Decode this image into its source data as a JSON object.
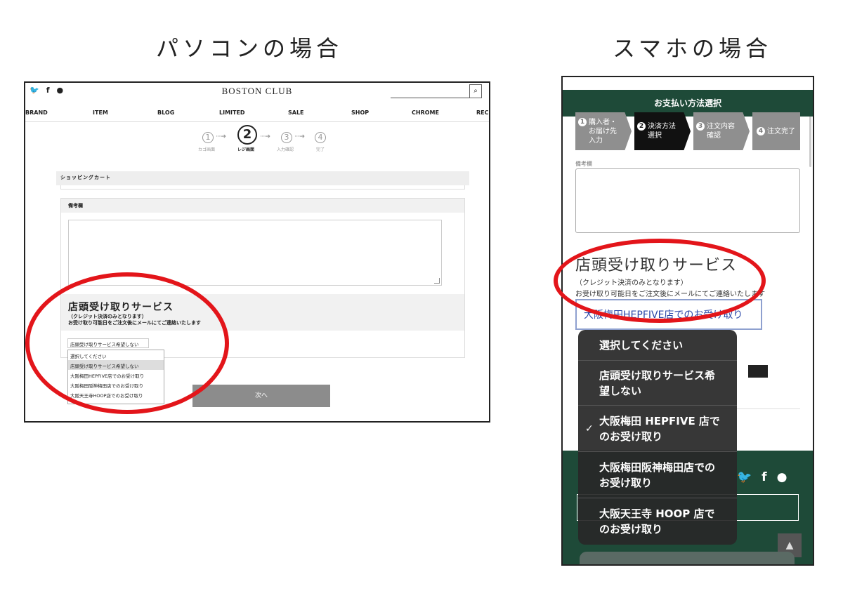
{
  "headings": {
    "pc": "パソコンの場合",
    "phone": "スマホの場合"
  },
  "pc": {
    "brand": "BOSTON CLUB",
    "social_icons": [
      "twitter-icon",
      "facebook-icon",
      "line-icon"
    ],
    "nav": [
      "BRAND",
      "ITEM",
      "BLOG",
      "LIMITED",
      "SALE",
      "SHOP",
      "CHROME",
      "RECI"
    ],
    "steps": [
      {
        "num": "1",
        "label": "カゴ画面"
      },
      {
        "num": "2",
        "label": "レジ画面"
      },
      {
        "num": "3",
        "label": "入力確認"
      },
      {
        "num": "4",
        "label": "完了"
      }
    ],
    "cart_title": "ショッピングカート",
    "remarks_title": "備考欄",
    "pickup_title": "店頭受け取りサービス",
    "pickup_sub1": "（クレジット決済のみとなります）",
    "pickup_sub2": "お受け取り可能日をご注文後にメールにてご連絡いたします",
    "select_value": "店頭受け取りサービス希望しない",
    "options": [
      "選択してください",
      "店頭受け取りサービス希望しない",
      "大阪梅田HEPFIVE店でのお受け取り",
      "大阪梅田阪神梅田店でのお受け取り",
      "大阪天王寺HOOP店でのお受け取り"
    ],
    "next_button": "次へ"
  },
  "phone": {
    "header_title": "お支払い方法選択",
    "steps": [
      {
        "num": "1",
        "label": "購入者・お届け先入力"
      },
      {
        "num": "2",
        "label": "決済方法選択"
      },
      {
        "num": "3",
        "label": "注文内容確認"
      },
      {
        "num": "4",
        "label": "注文完了"
      }
    ],
    "remarks_label": "備考欄",
    "pickup_title": "店頭受け取りサービス",
    "pickup_sub1": "（クレジット決済のみとなります）",
    "pickup_sub2": "お受け取り可能日をご注文後にメールにてご連絡いたします",
    "select_value": "大阪梅田HEPFIVE店でのお受け取り",
    "options": [
      {
        "label": "選択してください",
        "checked": false
      },
      {
        "label": "店頭受け取りサービス希望しない",
        "checked": false
      },
      {
        "label": "大阪梅田 HEPFIVE 店でのお受け取り",
        "checked": true
      },
      {
        "label": "大阪梅田阪神梅田店でのお受け取り",
        "checked": false
      },
      {
        "label": "大阪天王寺 HOOP 店でのお受け取り",
        "checked": false
      }
    ],
    "social_icons": [
      "twitter-icon",
      "facebook-icon",
      "line-icon"
    ]
  },
  "colors": {
    "highlight_red": "#e3151a",
    "header_green": "#1e4a38",
    "select_blue": "#2a47a8"
  }
}
